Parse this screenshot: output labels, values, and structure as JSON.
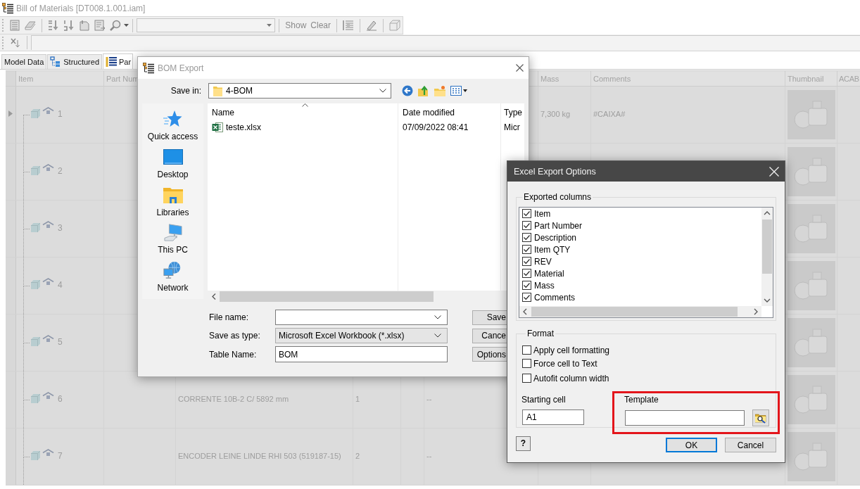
{
  "window": {
    "title": "Bill of Materials [DT008.1.001.iam]"
  },
  "toolbar": {
    "buttons": [
      "Show",
      "Clear"
    ]
  },
  "tabs": [
    {
      "label": "Model Data",
      "selected": false,
      "kind": "plain"
    },
    {
      "label": "Structured",
      "selected": false,
      "kind": "structured"
    },
    {
      "label": "Par",
      "selected": true,
      "kind": "parts"
    }
  ],
  "table": {
    "headers": {
      "item": "Item",
      "part_number": "Part Num",
      "mass": "Mass",
      "comments": "Comments",
      "thumbnail": "Thumbnail",
      "column_11": "ACAB"
    },
    "rows": [
      {
        "selected": true,
        "item": "1",
        "mass": "7,300 kg",
        "comments": "#CAIXA#"
      },
      {
        "selected": false,
        "item": "2"
      },
      {
        "selected": false,
        "item": "3"
      },
      {
        "selected": false,
        "item": "4"
      },
      {
        "selected": false,
        "item": "5"
      },
      {
        "selected": false,
        "item": "6",
        "column_3": "CORRENTE 10B-2 C/ 5892 mm",
        "column_4": "1",
        "column_6": "--"
      },
      {
        "selected": false,
        "item": "7",
        "column_3": "ENCODER LEINE LINDE RHI 503 (519187-15)",
        "column_4": "2",
        "column_6": "--"
      }
    ]
  },
  "bom_export": {
    "title": "BOM Export",
    "active": false,
    "save_in": {
      "label": "Save in:",
      "value": "4-BOM"
    },
    "places": [
      "Quick access",
      "Desktop",
      "Libraries",
      "This PC",
      "Network"
    ],
    "file_list": {
      "columns": [
        "Name",
        "Date modified",
        "Type"
      ],
      "rows": [
        {
          "name": "teste.xlsx",
          "date_modified": "07/09/2022 08:41",
          "type": "Micr"
        }
      ]
    },
    "fields": [
      {
        "label": "File name:",
        "kind": "combo"
      },
      {
        "label": "Save as type:",
        "kind": "dropdown",
        "value": "Microsoft Excel Workbook (*.xlsx)"
      },
      {
        "label": "Table Name:",
        "kind": "text",
        "value": "BOM"
      }
    ],
    "buttons": [
      "Save",
      "Cance",
      "Options"
    ]
  },
  "excel_options": {
    "title": "Excel Export Options",
    "active": true,
    "exported_columns": {
      "label": "Exported columns",
      "items": [
        {
          "label": "Item",
          "checked": true
        },
        {
          "label": "Part Number",
          "checked": true
        },
        {
          "label": "Description",
          "checked": true
        },
        {
          "label": "Item QTY",
          "checked": true
        },
        {
          "label": "REV",
          "checked": true
        },
        {
          "label": "Material",
          "checked": true
        },
        {
          "label": "Mass",
          "checked": true
        },
        {
          "label": "Comments",
          "checked": true
        }
      ]
    },
    "format": {
      "label": "Format",
      "options": [
        {
          "label": "Apply cell formatting",
          "checked": false
        },
        {
          "label": "Force cell to Text",
          "checked": false
        },
        {
          "label": "Autofit column width",
          "checked": false
        }
      ],
      "starting_cell": {
        "label": "Starting cell",
        "value": "A1"
      },
      "template": {
        "label": "Template",
        "highlighted": true
      }
    },
    "help_button": "?",
    "buttons": [
      {
        "label": "OK",
        "default": true
      },
      {
        "label": "Cancel",
        "default": false
      }
    ]
  }
}
